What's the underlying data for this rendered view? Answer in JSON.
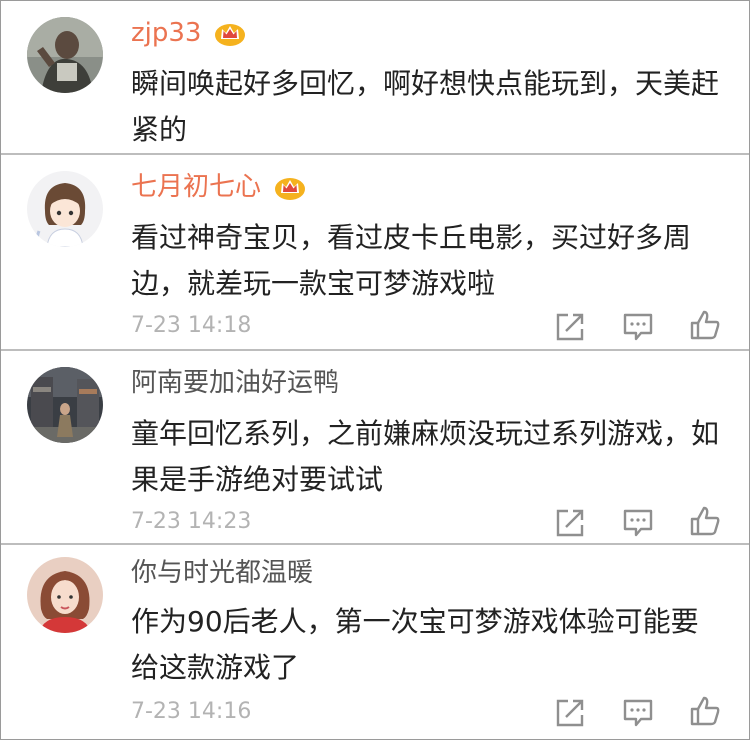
{
  "comments": [
    {
      "username": "zjp33",
      "vip": true,
      "text": "瞬间唤起好多回忆，啊好想快点能玩到，天美赶紧的",
      "time": ""
    },
    {
      "username": "七月初七心",
      "vip": true,
      "text": "看过神奇宝贝，看过皮卡丘电影，买过好多周边，就差玩一款宝可梦游戏啦",
      "time": "7-23 14:18"
    },
    {
      "username": "阿南要加油好运鸭",
      "vip": false,
      "text": "童年回忆系列，之前嫌麻烦没玩过系列游戏，如果是手游绝对要试试",
      "time": "7-23 14:23"
    },
    {
      "username": "你与时光都温暖",
      "vip": false,
      "text": "作为90后老人，第一次宝可梦游戏体验可能要给这款游戏了",
      "time": "7-23 14:16"
    }
  ],
  "icons": {
    "share": "share-icon",
    "comment": "comment-icon",
    "like": "like-icon",
    "vip": "crown-icon"
  },
  "colors": {
    "vip_name": "#eb7350",
    "plain_name": "#555555",
    "body_text": "#222222",
    "timestamp": "#b3b3b3",
    "crown": "#f5b21e"
  }
}
